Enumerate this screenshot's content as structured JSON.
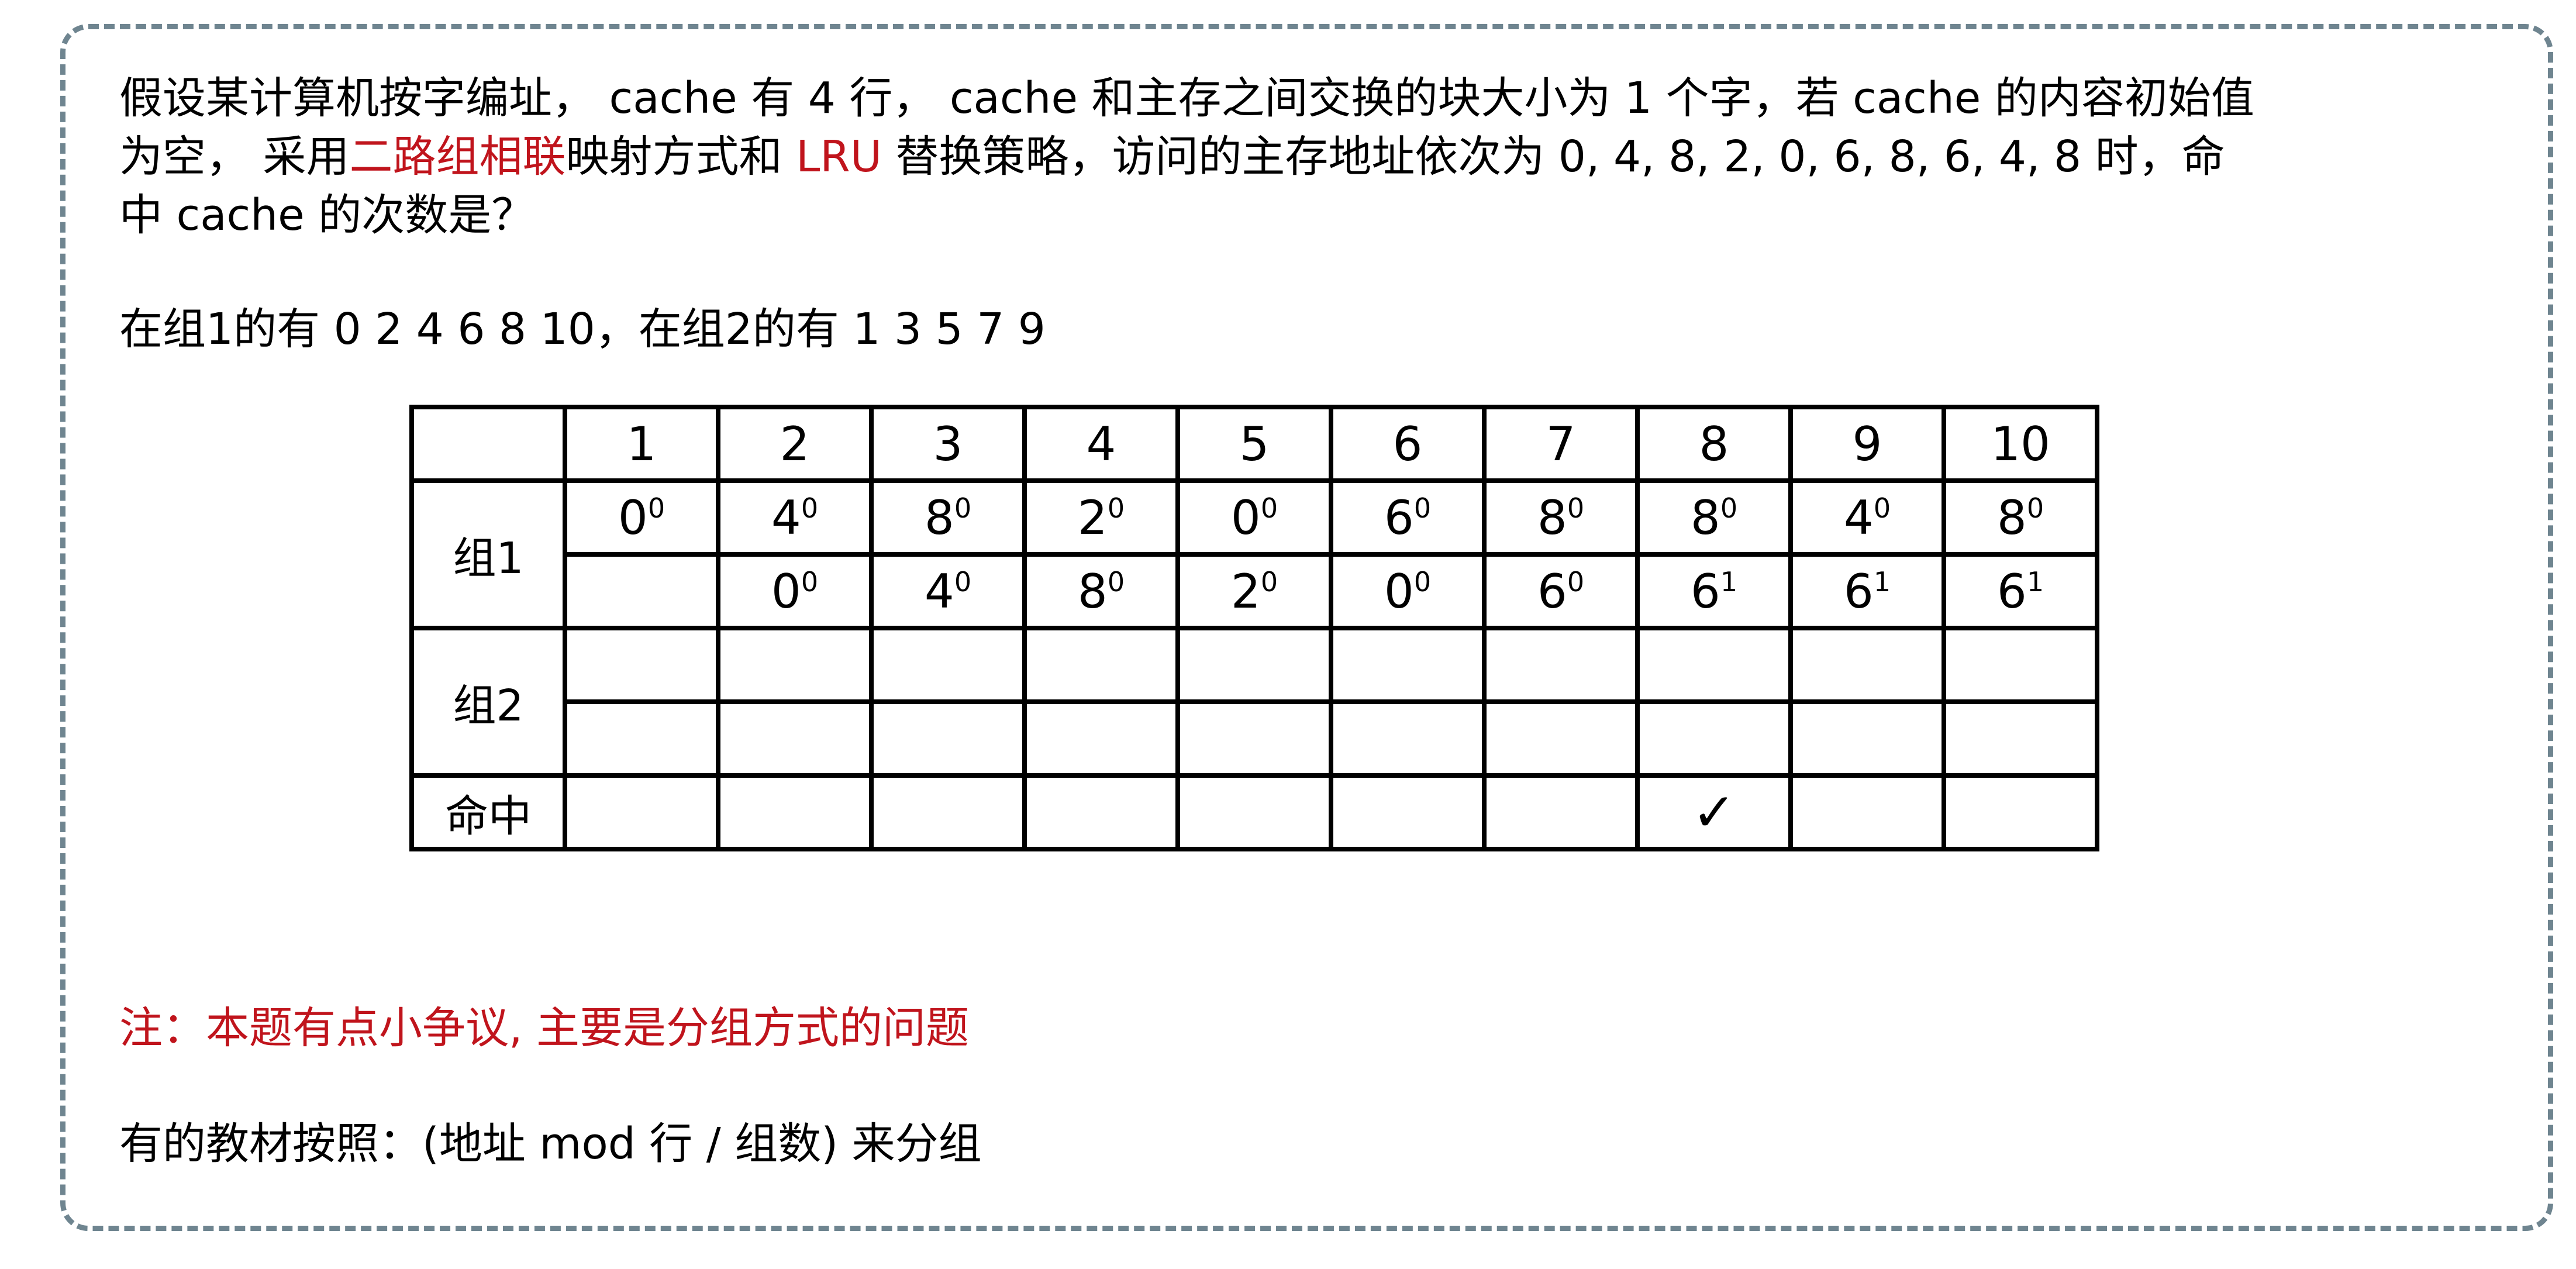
{
  "question": {
    "line1": "假设某计算机按字编址， cache 有 4 行， cache 和主存之间交换的块大小为 1 个字，若 cache 的内容初始值",
    "line2_a": "为空， 采用",
    "line2_red1": "二路组相联",
    "line2_b": "映射方式和 ",
    "line2_red2": "LRU",
    "line2_c": " 替换策略，访问的主存地址依次为 0, 4, 8, 2, 0, 6, 8, 6, 4, 8 时，命",
    "line3": "中 cache 的次数是？"
  },
  "groups_line": "在组1的有 0 2 4 6 8 10，在组2的有 1 3 5 7 9",
  "table": {
    "headers": [
      "",
      "1",
      "2",
      "3",
      "4",
      "5",
      "6",
      "7",
      "8",
      "9",
      "10"
    ],
    "group1_label": "组1",
    "group2_label": "组2",
    "hit_label": "命中",
    "group1_row1": [
      {
        "v": "0",
        "s": "0"
      },
      {
        "v": "4",
        "s": "0"
      },
      {
        "v": "8",
        "s": "0"
      },
      {
        "v": "2",
        "s": "0"
      },
      {
        "v": "0",
        "s": "0"
      },
      {
        "v": "6",
        "s": "0"
      },
      {
        "v": "8",
        "s": "0"
      },
      {
        "v": "8",
        "s": "0"
      },
      {
        "v": "4",
        "s": "0"
      },
      {
        "v": "8",
        "s": "0"
      }
    ],
    "group1_row2": [
      {
        "v": "",
        "s": ""
      },
      {
        "v": "0",
        "s": "0"
      },
      {
        "v": "4",
        "s": "0"
      },
      {
        "v": "8",
        "s": "0"
      },
      {
        "v": "2",
        "s": "0"
      },
      {
        "v": "0",
        "s": "0"
      },
      {
        "v": "6",
        "s": "0"
      },
      {
        "v": "6",
        "s": "1"
      },
      {
        "v": "6",
        "s": "1"
      },
      {
        "v": "6",
        "s": "1"
      }
    ],
    "hits": [
      "",
      "",
      "",
      "",
      "",
      "",
      "",
      "✓",
      "",
      ""
    ]
  },
  "note": "注：本题有点小争议, 主要是分组方式的问题",
  "textbook": "有的教材按照：(地址 mod 行 / 组数) 来分组",
  "colors": {
    "accent_red": "#c0141c",
    "frame_border": "#6f8590"
  }
}
